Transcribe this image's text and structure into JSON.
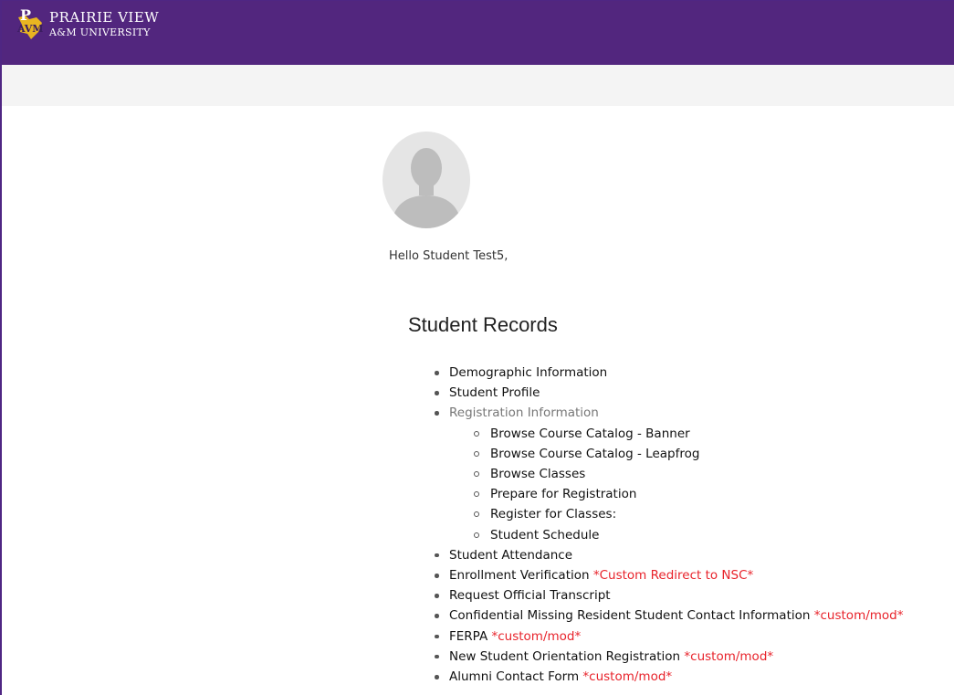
{
  "header": {
    "brand_line1": "PRAIRIE VIEW",
    "brand_line2": "A&M UNIVERSITY",
    "brand_color": "#52267e",
    "logo_icon": "pvamu-logo"
  },
  "profile": {
    "avatar_icon": "user-silhouette",
    "greeting": "Hello Student Test5,"
  },
  "section": {
    "title": "Student Records",
    "items": [
      {
        "label": "Demographic Information",
        "note": ""
      },
      {
        "label": "Student Profile",
        "note": ""
      },
      {
        "label": "Registration Information",
        "note": "",
        "sub_items": [
          "Browse Course Catalog - Banner",
          "Browse Course Catalog - Leapfrog",
          "Browse Classes",
          "Prepare for Registration",
          "Register for Classes:",
          "Student Schedule"
        ]
      },
      {
        "label": "Student Attendance",
        "note": ""
      },
      {
        "label": "Enrollment Verification",
        "note": "*Custom Redirect to NSC*"
      },
      {
        "label": "Request Official Transcript",
        "note": ""
      },
      {
        "label": "Confidential Missing Resident Student Contact Information",
        "note": "*custom/mod*"
      },
      {
        "label": "FERPA",
        "note": "*custom/mod*"
      },
      {
        "label": "New Student Orientation Registration",
        "note": "*custom/mod*"
      },
      {
        "label": "Alumni Contact Form",
        "note": "*custom/mod*"
      }
    ]
  },
  "colors": {
    "accent": "#52267e",
    "custom_note": "#e8232b",
    "muted": "#777777"
  }
}
